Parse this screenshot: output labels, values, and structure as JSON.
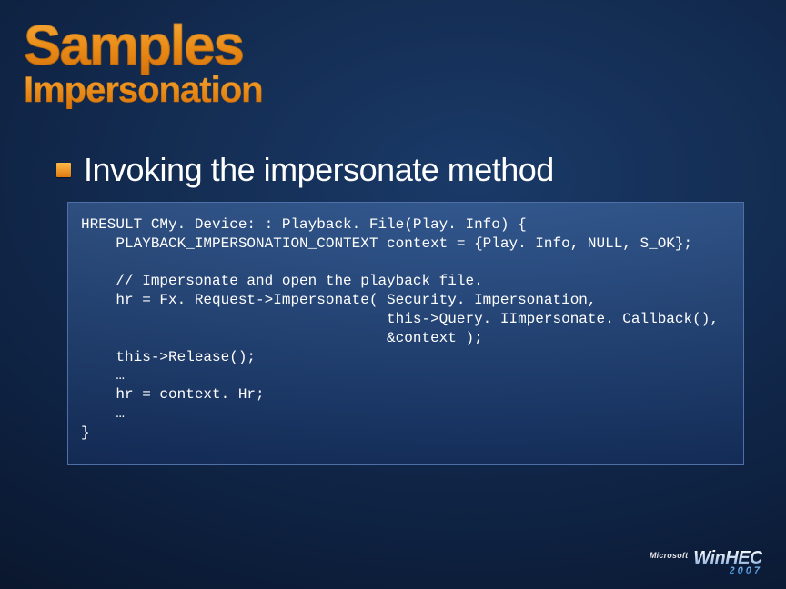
{
  "slide": {
    "title": "Samples",
    "subtitle": "Impersonation",
    "bullet": "Invoking the impersonate method",
    "code": "HRESULT CMy. Device: : Playback. File(Play. Info) {\n    PLAYBACK_IMPERSONATION_CONTEXT context = {Play. Info, NULL, S_OK};\n\n    // Impersonate and open the playback file.\n    hr = Fx. Request->Impersonate( Security. Impersonation,\n                                   this->Query. IImpersonate. Callback(),\n                                   &context );\n    this->Release();\n    …\n    hr = context. Hr;\n    …\n}"
  },
  "footer": {
    "vendor": "Microsoft",
    "event": "WinHEC",
    "year": "2007"
  }
}
